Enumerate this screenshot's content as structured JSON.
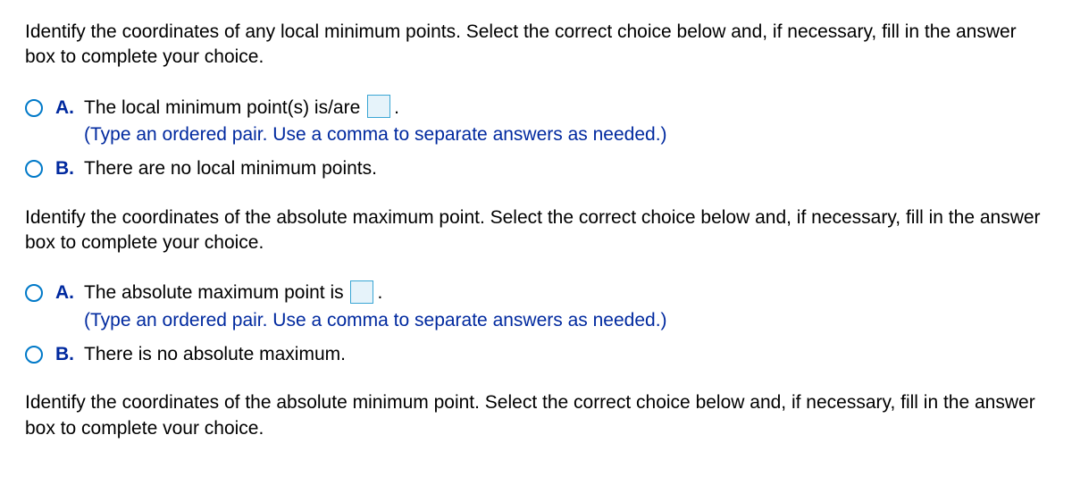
{
  "q1": {
    "prompt": "Identify the coordinates of any local minimum points. Select the correct choice below and, if necessary, fill in the answer box to complete your choice.",
    "A": {
      "letter": "A.",
      "text_before": "The local minimum point(s) is/are ",
      "period": ".",
      "hint": "(Type an ordered pair. Use a comma to separate answers as needed.)"
    },
    "B": {
      "letter": "B.",
      "text": "There are no local minimum points."
    }
  },
  "q2": {
    "prompt": "Identify the coordinates of the absolute maximum point. Select the correct choice below and, if necessary, fill in the answer box to complete your choice.",
    "A": {
      "letter": "A.",
      "text_before": "The absolute maximum point is ",
      "period": ".",
      "hint": "(Type an ordered pair. Use a comma to separate answers as needed.)"
    },
    "B": {
      "letter": "B.",
      "text": "There is no absolute maximum."
    }
  },
  "q3": {
    "prompt": "Identify the coordinates of the absolute minimum point. Select the correct choice below and, if necessary, fill in the answer box to complete vour choice."
  }
}
